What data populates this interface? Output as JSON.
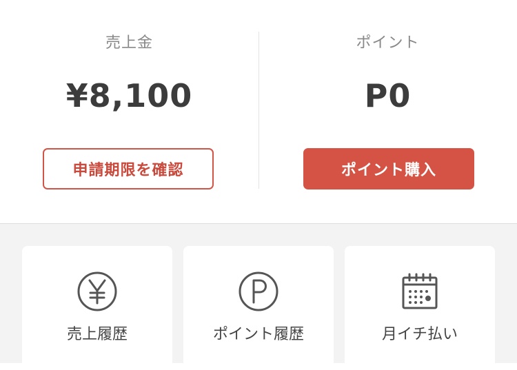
{
  "balance": {
    "sales": {
      "label": "売上金",
      "value": "¥8,100",
      "button_label": "申請期限を確認"
    },
    "points": {
      "label": "ポイント",
      "value": "P0",
      "button_label": "ポイント購入"
    }
  },
  "shortcuts": [
    {
      "label": "売上履歴",
      "icon": "yen-circle-icon"
    },
    {
      "label": "ポイント履歴",
      "icon": "p-circle-icon"
    },
    {
      "label": "月イチ払い",
      "icon": "calendar-icon"
    }
  ],
  "colors": {
    "accent": "#d45345",
    "accent_text": "#c94a3c",
    "icon": "#555555",
    "background_secondary": "#f3f3f3"
  }
}
